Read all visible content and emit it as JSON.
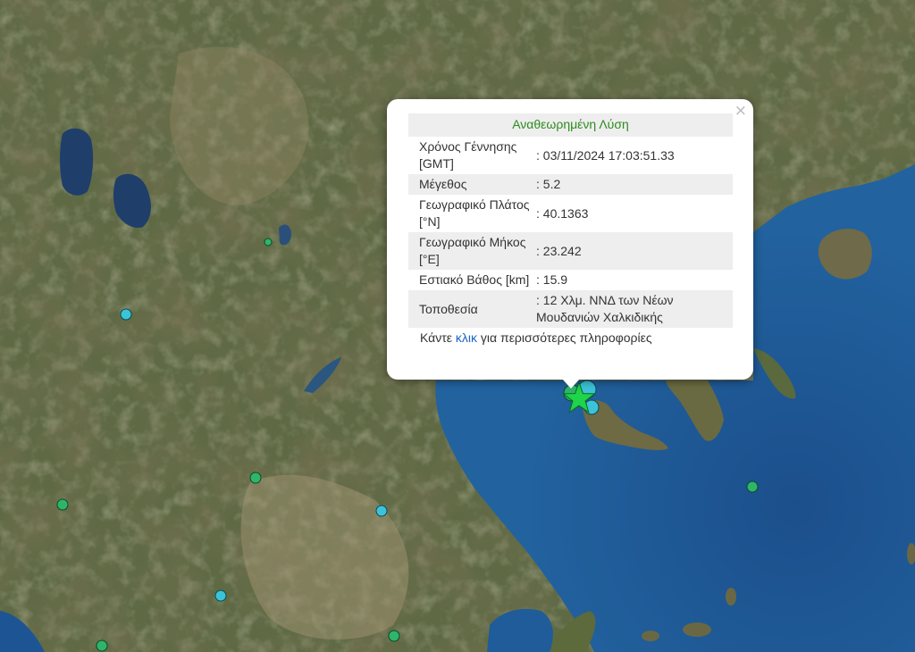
{
  "popup": {
    "title": "Αναθεωρημένη Λύση",
    "close_label": "×",
    "rows": [
      {
        "label": "Χρόνος Γέννησης [GMT]",
        "value": ": 03/11/2024 17:03:51.33"
      },
      {
        "label": "Μέγεθος",
        "value": ": 5.2"
      },
      {
        "label": "Γεωγραφικό Πλάτος [°N]",
        "value": ": 40.1363"
      },
      {
        "label": "Γεωγραφικό Μήκος [°E]",
        "value": ": 23.242"
      },
      {
        "label": "Εστιακό Βάθος [km]",
        "value": ": 15.9"
      },
      {
        "label": "Τοποθεσία",
        "value": ": 12 Χλμ. ΝΝΔ των Νέων Μουδανιών Χαλκιδικής"
      }
    ],
    "footer_prefix": "Κάντε ",
    "footer_link": "κλικ",
    "footer_suffix": " για περισσότερες πληροφορίες"
  },
  "colors": {
    "land": "#5f6a45",
    "sea": "#1d5594",
    "title_green": "#2e8b1f",
    "link_blue": "#1a64c8",
    "marker_cyan": "#3cc3d8",
    "marker_green": "#2fb56a",
    "epicenter_star": "#1fd34a"
  },
  "markers": {
    "epicenter_icon": "star-icon",
    "event_icon": "circle-icon"
  }
}
